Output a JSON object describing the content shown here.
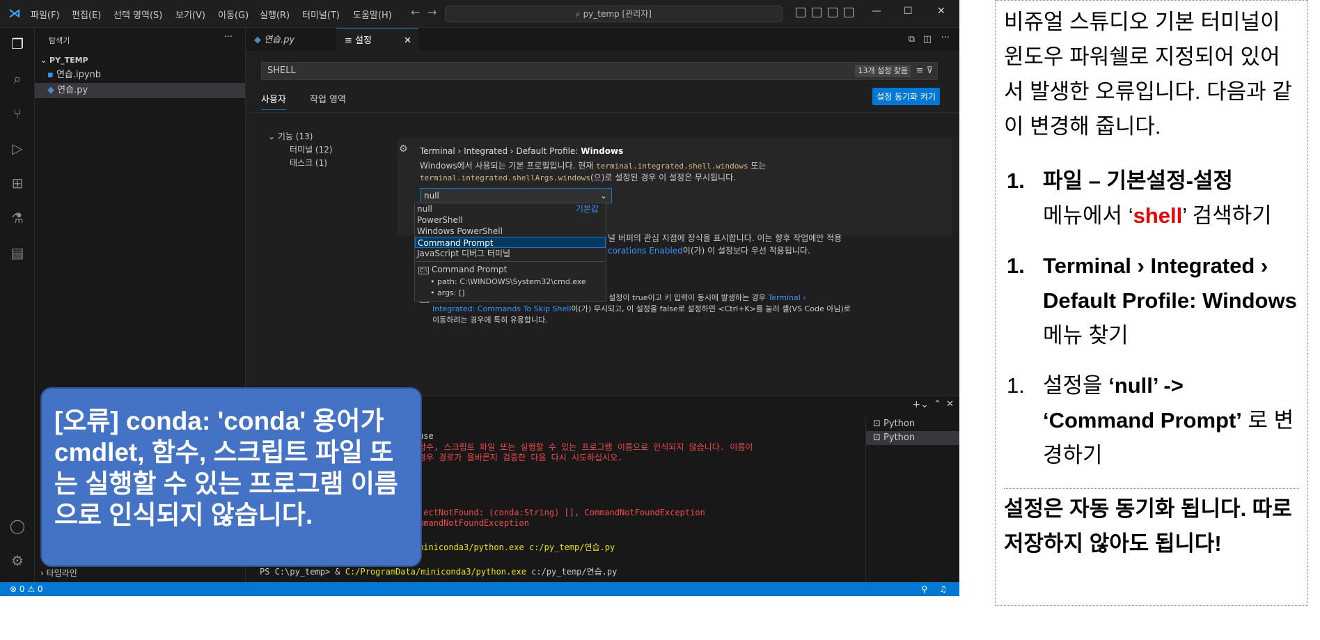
{
  "titlebar": {
    "menus": [
      "파일(F)",
      "편집(E)",
      "선택 영역(S)",
      "보기(V)",
      "이동(G)",
      "실행(R)",
      "터미널(T)",
      "도움말(H)"
    ],
    "search": "py_temp [관리자]"
  },
  "sidebar": {
    "title": "탐색기",
    "folder": "PY_TEMP",
    "files": [
      "연습.ipynb",
      "연습.py"
    ],
    "timeline": "타임라인"
  },
  "tabs": [
    {
      "label": "연습.py"
    },
    {
      "label": "설정"
    }
  ],
  "settings": {
    "search_value": "SHELL",
    "result_count": "13개 설정 찾음",
    "scopes": [
      "사용자",
      "작업 영역"
    ],
    "sync_button": "설정 동기화 켜기",
    "toc": {
      "feature": "기능 (13)",
      "terminal": "터미널 (12)",
      "task": "태스크 (1)"
    },
    "setting_title_prefix": "Terminal › Integrated › Default Profile:",
    "setting_title_bold": "Windows",
    "desc1": "Windows에서 사용되는 기본 프로필입니다. 현재",
    "desc_code1": "terminal.integrated.shell.windows",
    "desc2": "또는",
    "desc_code2": "terminal.integrated.shellArgs.windows",
    "desc3": "(으)로 설정된 경우 이 설정은 무시됩니다.",
    "dropdown_value": "null",
    "options": [
      "null",
      "PowerShell",
      "Windows PowerShell",
      "Command Prompt",
      "JavaScript 디버그 터미널"
    ],
    "default_label": "기본값",
    "option_detail_title": "Command Prompt",
    "option_detail_path": "path: C:\\WINDOWS\\System32\\cmd.exe",
    "option_detail_args": "args: []",
    "bg_line1": "널 버퍼의 관심 지점에 장식을 표시합니다. 이는 향후 작업에만 적용",
    "bg_line2a": "corations Enabled",
    "bg_line2b": "이(가) 이 설정보다 우선 적용됩니다.",
    "bg_line3": "터미널에서 명령 키 바인딩을 사용할지 여부입니다. 이 설정이 true이고 키 입력이 동시에 발생하는 경우",
    "bg_link3": "Terminal ›",
    "bg_link4": "Integrated: Commands To Skip Shell",
    "bg_line4": "이(가) 무시되고, 이 설정을 false로 설정하면 <Ctrl+K>를 눌러 셸(VS Code 아님)로",
    "bg_line5": "이동하려는 경우에 특히 유용합니다."
  },
  "terminal": {
    "line_use": "use",
    "err1": "함수, 스크립트 파일 또는 실행할 수 있는 프로그램 이름으로 인식되지 않습니다. 이름이",
    "err2": "경우 경로가 올바른지 검증한 다음 다시 시도하십시오.",
    "err3": "jectNotFound: (conda:String) [], CommandNotFoundException",
    "err4": "mmandNotFoundException",
    "cmd1": "miniconda3/python.exe c:/py_temp/연습.py",
    "prompt": "PS C:\\py_temp> & ",
    "prompt_path": "C:/ProgramData/miniconda3/python.exe",
    "prompt_arg": " c:/py_temp/연습.py",
    "list": [
      "Python",
      "Python"
    ]
  },
  "statusbar": {
    "problems": "⊗ 0 ⚠ 0"
  },
  "callout": "[오류] conda: 'conda' 용어가 cmdlet, 함수, 스크립트 파일 또는 실행할 수 있는 프로그램 이름으로 인식되지 않습니다.",
  "notes": {
    "intro": "비쥬얼 스튜디오 기본 터미널이 윈도우 파워쉘로 지정되어 있어서 발생한 오류입니다. 다음과 같이 변경해 줍니다.",
    "step1_bold": "파일 – 기본설정-설정",
    "step1_pre": "메뉴에서 ‘",
    "step1_red": "shell",
    "step1_post": "’ 검색하기",
    "step2_bold": "Terminal › Integrated › Default Profile: Windows",
    "step2_rest": "메뉴 찾기",
    "step3_pre": "설정을 ",
    "step3_bold": "‘null’ -> ‘Command Prompt’",
    "step3_post": "로 변경하기",
    "outro": "설정은 자동 동기화 됩니다. 따로 저장하지 않아도 됩니다!",
    "num": "1."
  }
}
